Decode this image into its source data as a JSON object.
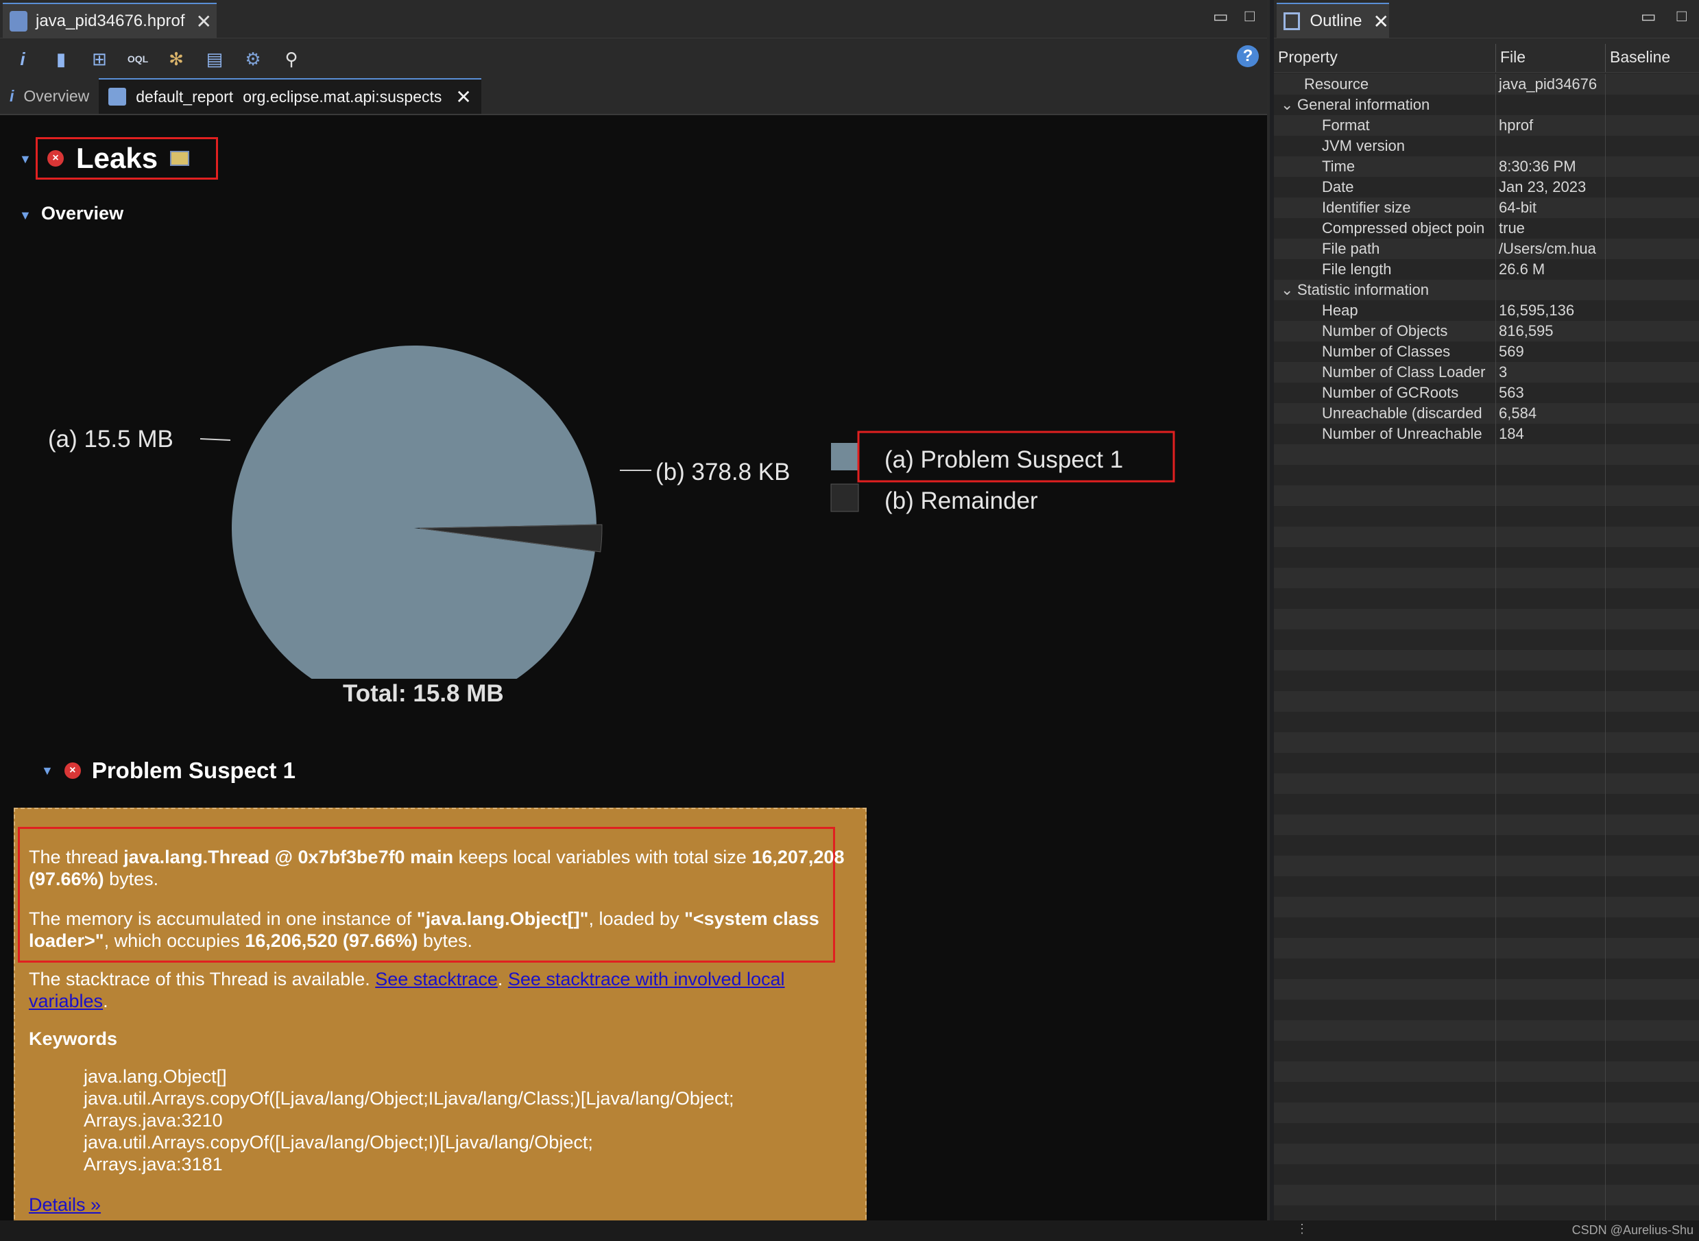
{
  "editor": {
    "file_tab": "java_pid34676.hprof",
    "subtabs": {
      "overview": "Overview",
      "report_name": "default_report",
      "report_id": "org.eclipse.mat.api:suspects"
    }
  },
  "report": {
    "leaks_title": "Leaks",
    "overview_heading": "Overview",
    "problem_heading": "Problem Suspect 1",
    "total": "Total: 15.8 MB",
    "chart_data": {
      "type": "pie",
      "unit": "MB",
      "slices": [
        {
          "key": "(a)",
          "label": "15.5 MB",
          "value": 15.5,
          "legend": "Problem Suspect 1",
          "color": "#738a98"
        },
        {
          "key": "(b)",
          "label": "378.8 KB",
          "value": 0.3788,
          "legend": "Remainder",
          "color": "#2a2a2a"
        }
      ]
    },
    "para1": {
      "t1": "The thread ",
      "b1": "java.lang.Thread @ 0x7bf3be7f0 main",
      "t2": " keeps local variables with total size ",
      "b2": "16,207,208 (97.66%)",
      "t3": " bytes."
    },
    "para2": {
      "t1": "The memory is accumulated in one instance of ",
      "b1": "\"java.lang.Object[]\"",
      "t2": ", loaded by ",
      "b2": "\"<system class loader>\"",
      "t3": ", which occupies ",
      "b3": "16,206,520 (97.66%)",
      "t4": " bytes."
    },
    "para3": {
      "t1": "The stacktrace of this Thread is available. ",
      "link1": "See stacktrace",
      "t2": ". ",
      "link2": "See stacktrace with involved local variables",
      "t3": "."
    },
    "keywords_heading": "Keywords",
    "keywords": [
      "java.lang.Object[]",
      "java.util.Arrays.copyOf([Ljava/lang/Object;ILjava/lang/Class;)[Ljava/lang/Object;",
      "Arrays.java:3210",
      "java.util.Arrays.copyOf([Ljava/lang/Object;I)[Ljava/lang/Object;",
      "Arrays.java:3181"
    ],
    "details_link": "Details »"
  },
  "outline": {
    "tab": "Outline",
    "columns": [
      "Property",
      "File",
      "Baseline"
    ],
    "rows": [
      {
        "level": 1,
        "name": "Resource",
        "file": "java_pid34676"
      },
      {
        "level": 0,
        "name": "General information",
        "file": ""
      },
      {
        "level": 2,
        "name": "Format",
        "file": "hprof"
      },
      {
        "level": 2,
        "name": "JVM version",
        "file": ""
      },
      {
        "level": 2,
        "name": "Time",
        "file": "8:30:36 PM"
      },
      {
        "level": 2,
        "name": "Date",
        "file": "Jan 23, 2023"
      },
      {
        "level": 2,
        "name": "Identifier size",
        "file": "64-bit"
      },
      {
        "level": 2,
        "name": "Compressed object poin",
        "file": "true"
      },
      {
        "level": 2,
        "name": "File path",
        "file": "/Users/cm.hua"
      },
      {
        "level": 2,
        "name": "File length",
        "file": "26.6 M"
      },
      {
        "level": 0,
        "name": "Statistic information",
        "file": ""
      },
      {
        "level": 2,
        "name": "Heap",
        "file": "16,595,136"
      },
      {
        "level": 2,
        "name": "Number of Objects",
        "file": "816,595"
      },
      {
        "level": 2,
        "name": "Number of Classes",
        "file": "569"
      },
      {
        "level": 2,
        "name": "Number of Class Loader",
        "file": "3"
      },
      {
        "level": 2,
        "name": "Number of GCRoots",
        "file": "563"
      },
      {
        "level": 2,
        "name": "Unreachable (discarded",
        "file": "6,584"
      },
      {
        "level": 2,
        "name": "Number of Unreachable",
        "file": "184"
      }
    ],
    "empty_rows": 38
  },
  "status": {
    "credit": "CSDN @Aurelius-Shu"
  }
}
